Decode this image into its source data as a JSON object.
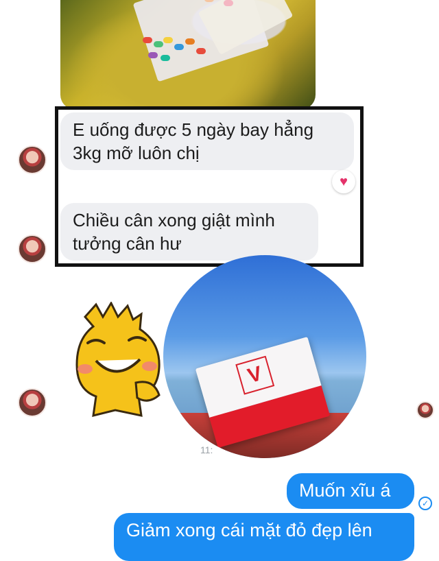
{
  "messages": {
    "received_1": "E uống được 5 ngày bay hẳng 3kg mỡ luôn chị",
    "received_2": "Chiều cân xong giật mình tưởng cân hư",
    "sent_1": "Muốn xĩu á",
    "sent_2": "Giảm xong cái mặt đỏ đẹp lên"
  },
  "timestamp": "11:",
  "reaction": "heart",
  "colors": {
    "sent_bubble": "#1b8cf2",
    "received_bubble": "#eeeff2",
    "frame": "#111111",
    "heart": "#e4326a"
  },
  "icons": {
    "heart_reaction": "♥",
    "seen_check": "✓"
  }
}
